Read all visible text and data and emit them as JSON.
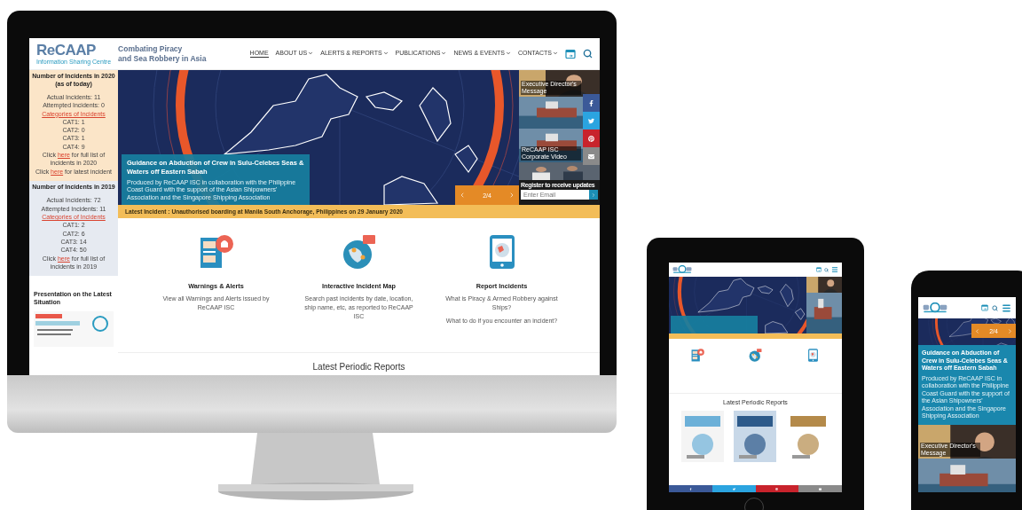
{
  "desktop": {
    "logo": {
      "wordmark": "ReCAAP",
      "caption": "Information Sharing Centre"
    },
    "tagline": [
      "Combating Piracy",
      "and Sea Robbery in Asia"
    ],
    "nav": [
      {
        "label": "HOME",
        "selected": true,
        "dropdown": false
      },
      {
        "label": "ABOUT US",
        "selected": false,
        "dropdown": true
      },
      {
        "label": "ALERTS & REPORTS",
        "selected": false,
        "dropdown": true
      },
      {
        "label": "PUBLICATIONS",
        "selected": false,
        "dropdown": true
      },
      {
        "label": "NEWS & EVENTS",
        "selected": false,
        "dropdown": true
      },
      {
        "label": "CONTACTS",
        "selected": false,
        "dropdown": true
      }
    ],
    "sidebar": {
      "blocks": [
        {
          "title": "Number of Incidents in 2020",
          "subtitle": "(as of today)",
          "color": "#fbe5c8",
          "lines": [
            {
              "kind": "text",
              "text": "Actual Incidents: 11"
            },
            {
              "kind": "text",
              "text": "Attempted Incidents: 0"
            },
            {
              "kind": "link",
              "text": "Categories of Incidents"
            },
            {
              "kind": "text",
              "text": "CAT1: 1"
            },
            {
              "kind": "text",
              "text": "CAT2: 0"
            },
            {
              "kind": "text",
              "text": "CAT3: 1"
            },
            {
              "kind": "text",
              "text": "CAT4: 9"
            },
            {
              "kind": "sentence",
              "before": "Click ",
              "link": "here",
              "after": " for full list of incidents in 2020"
            },
            {
              "kind": "sentence",
              "before": "Click ",
              "link": "here",
              "after": " for latest incident"
            }
          ]
        },
        {
          "title": "Number of Incidents in 2019",
          "color": "#e6eaf1",
          "lines": [
            {
              "kind": "text",
              "text": "Actual Incidents: 72"
            },
            {
              "kind": "text",
              "text": "Attempted Incidents: 11"
            },
            {
              "kind": "link",
              "text": "Categories of Incidents"
            },
            {
              "kind": "text",
              "text": "CAT1: 2"
            },
            {
              "kind": "text",
              "text": "CAT2: 6"
            },
            {
              "kind": "text",
              "text": "CAT3: 14"
            },
            {
              "kind": "text",
              "text": "CAT4: 50"
            },
            {
              "kind": "sentence",
              "before": "Click ",
              "link": "here",
              "after": " for full list of incidents in 2019"
            }
          ]
        }
      ],
      "presentation_title": "Presentation on the Latest Situation"
    },
    "hero": {
      "caption_title": "Guidance on Abduction of Crew in Sulu-Celebes Seas & Waters off Eastern Sabah",
      "caption_text": "Produced by ReCAAP ISC in collaboration with the Philippine Coast Guard with the support of the Asian Shipowners' Association and the Singapore Shipping Association",
      "slide": "2/4",
      "tiles": [
        {
          "kind": "person",
          "caption": "Executive Director's Message"
        },
        {
          "kind": "ship"
        },
        {
          "kind": "ship",
          "caption": "ReCAAP ISC Corporate Video"
        },
        {
          "kind": "people"
        }
      ],
      "register": {
        "label": "Register to receive updates",
        "placeholder": "Enter Email"
      },
      "social": [
        {
          "kind": "facebook"
        },
        {
          "kind": "twitter"
        },
        {
          "kind": "pinterest"
        },
        {
          "kind": "email"
        }
      ]
    },
    "ticker": "Latest Incident : Unauthorised boarding at Manila South Anchorage, Philippines on 29 January 2020",
    "features": [
      {
        "kind": "alerts",
        "title": "Warnings & Alerts",
        "lines": [
          "View all Warnings and Alerts issued by ReCAAP ISC"
        ]
      },
      {
        "kind": "map",
        "title": "Interactive Incident Map",
        "lines": [
          "Search past incidents by date, location, ship name, etc, as reported to ReCAAP ISC"
        ]
      },
      {
        "kind": "report",
        "title": "Report Incidents",
        "lines": [
          "What is Piracy & Armed Robbery against Ships?",
          "What to do if you encounter an incident?"
        ]
      }
    ],
    "section_title": "Latest Periodic Reports"
  },
  "tablet": {
    "features": [
      {
        "kind": "alerts"
      },
      {
        "kind": "map"
      },
      {
        "kind": "report"
      }
    ],
    "section_title": "Latest Periodic Reports",
    "social": [
      {
        "kind": "facebook"
      },
      {
        "kind": "twitter"
      },
      {
        "kind": "pinterest"
      },
      {
        "kind": "email"
      }
    ]
  },
  "phone": {
    "slide": "2/4",
    "caption_title": "Guidance on Abduction of Crew in Sulu-Celebes Seas & Waters off Eastern Sabah",
    "caption_text": "Produced by ReCAAP ISC in collaboration with the Philippine Coast Guard with the support of the Asian Shipowners' Association and the Singapore Shipping Association",
    "tiles": [
      {
        "kind": "person",
        "caption": "Executive Director's Message"
      },
      {
        "kind": "ship"
      }
    ]
  }
}
